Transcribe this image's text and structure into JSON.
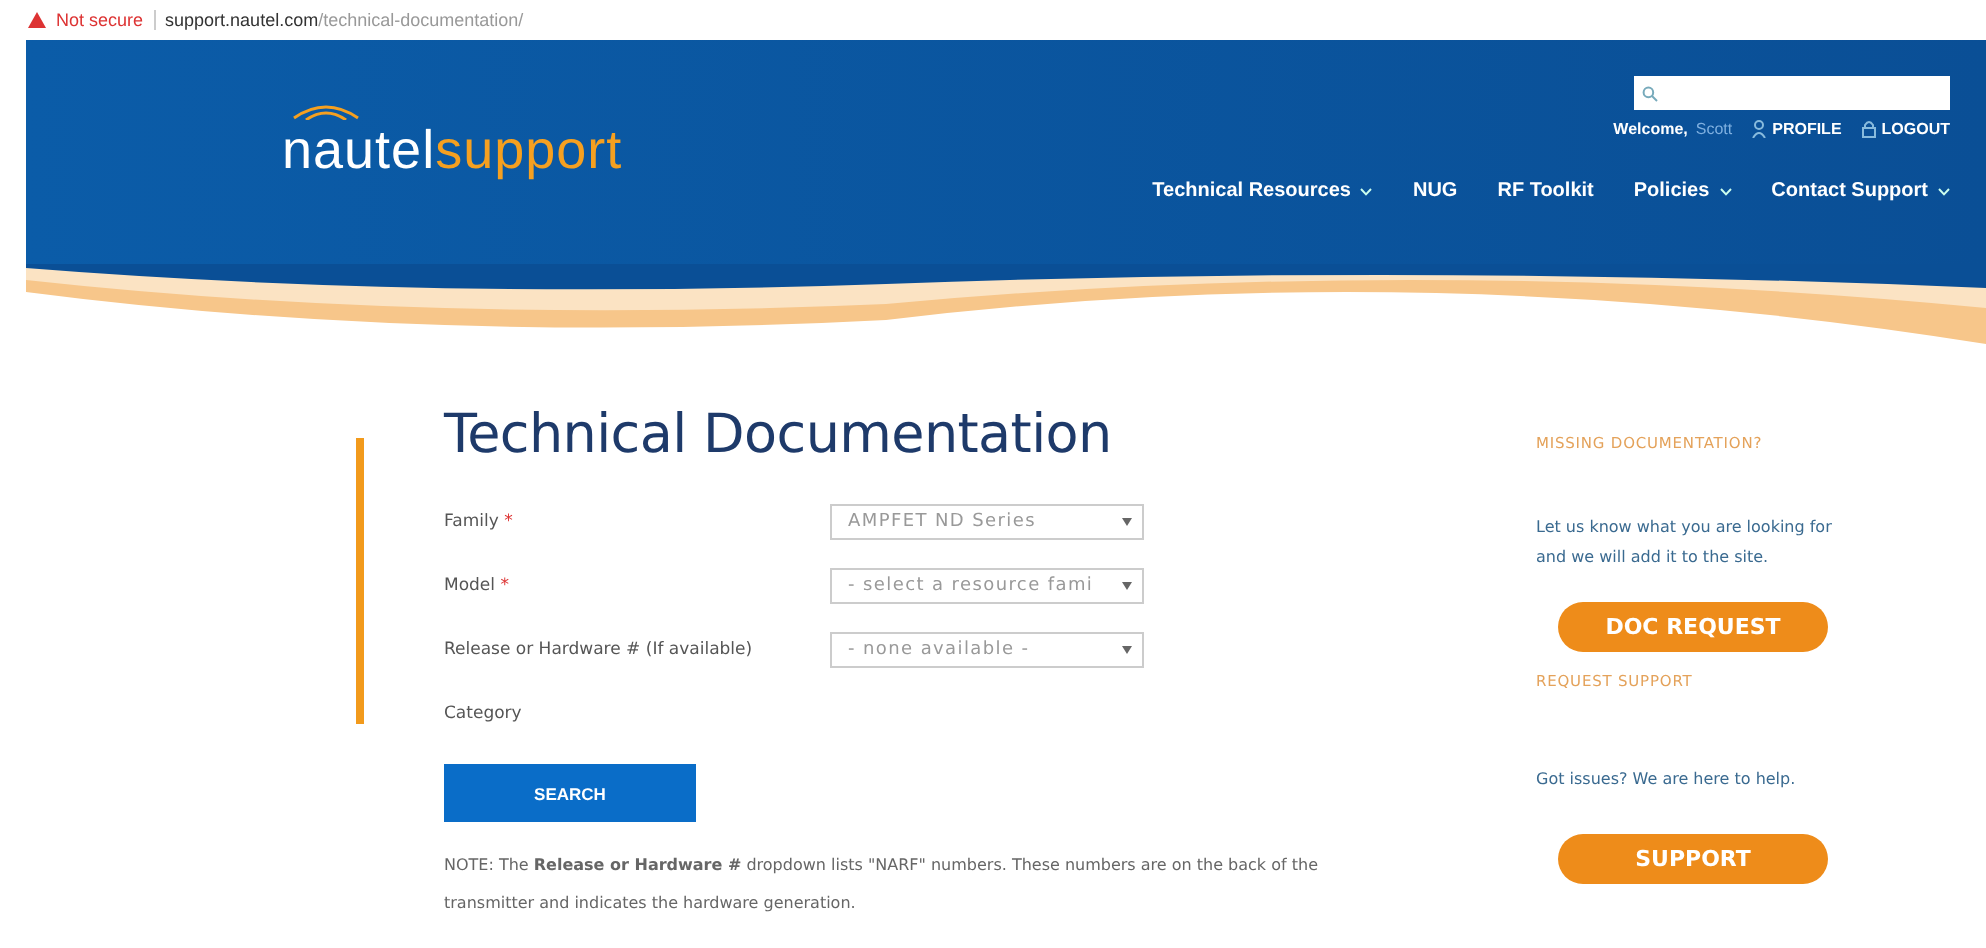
{
  "address_bar": {
    "security": "Not secure",
    "url_host": "support.nautel.com",
    "url_path": "/technical-documentation/"
  },
  "header": {
    "logo": {
      "part_1": "nautel",
      "part_2": "support"
    },
    "welcome": "Welcome,",
    "user": "Scott",
    "links": [
      "PROFILE",
      "LOGOUT"
    ],
    "nav": [
      {
        "label": "Technical Resources",
        "has_menu": true
      },
      {
        "label": "NUG",
        "has_menu": false
      },
      {
        "label": "RF Toolkit",
        "has_menu": false
      },
      {
        "label": "Policies",
        "has_menu": true
      },
      {
        "label": "Contact Support",
        "has_menu": true
      }
    ]
  },
  "page": {
    "title": "Technical Documentation",
    "fields": [
      {
        "label": "Family",
        "marker": "*",
        "kind": "select",
        "value": "AMPFET ND Series"
      },
      {
        "label": "Model",
        "marker": "*",
        "kind": "select",
        "value": "- select a resource fami"
      },
      {
        "label": "Release or Hardware # (If available)",
        "kind": "select",
        "value": "- none available -"
      },
      {
        "label": "Category",
        "kind": "none"
      }
    ],
    "search_button": "SEARCH",
    "note": "NOTE: The **Release or Hardware #** dropdown lists \"NARF\" numbers. These numbers are on the back of the transmitter and indicates the hardware generation."
  },
  "sidebar": [
    {
      "heading": "MISSING DOCUMENTATION?",
      "text": "Let us know what you are looking for and we will add it to the site.",
      "button": "DOC REQUEST"
    },
    {
      "heading": "REQUEST SUPPORT",
      "text": "Got issues? We are here to help.",
      "button": "SUPPORT"
    }
  ]
}
